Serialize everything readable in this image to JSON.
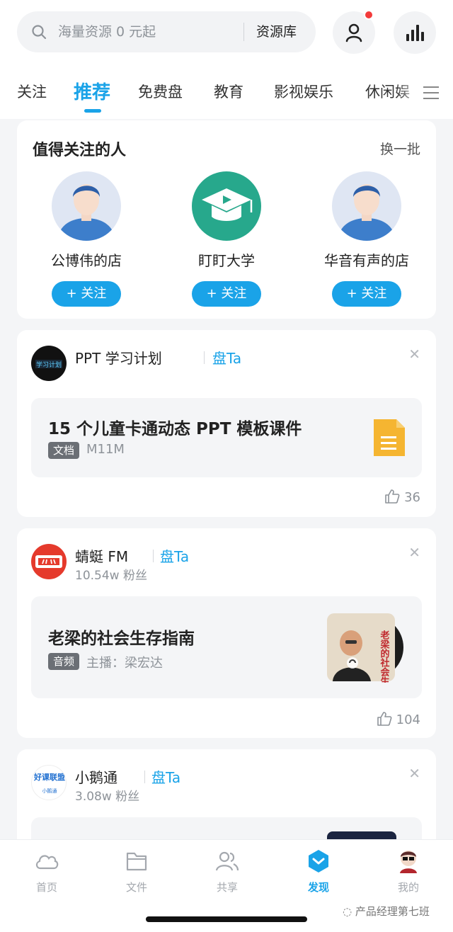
{
  "search": {
    "placeholder": "海量资源 0 元起",
    "library_label": "资源库"
  },
  "tabs": [
    "关注",
    "推荐",
    "免费盘",
    "教育",
    "影视娱乐",
    "休闲娱"
  ],
  "follow_section": {
    "title": "值得关注的人",
    "swap_label": "换一批",
    "people": [
      {
        "name": "公博伟的店",
        "button": "+ 关注"
      },
      {
        "name": "盯盯大学",
        "button": "+ 关注"
      },
      {
        "name": "华音有声的店",
        "button": "+ 关注"
      }
    ]
  },
  "feeds": [
    {
      "name": "PPT 学习计划",
      "pan_label": "盘Ta",
      "fans": "",
      "logo_text": "学习计划",
      "item_title": "15 个儿童卡通动态 PPT 模板课件",
      "tag": "文档",
      "meta": "M11M",
      "likes": "36"
    },
    {
      "name": "蜻蜓 FM",
      "pan_label": "盘Ta",
      "fans": "10.54w 粉丝",
      "item_title": "老梁的社会生存指南",
      "tag": "音频",
      "meta": "主播：梁宏达",
      "cover_text": "老梁的社会生存指南",
      "likes": "104"
    },
    {
      "name": "小鹅通",
      "pan_label": "盘Ta",
      "fans": "3.08w 粉丝",
      "logo_text": "好课联盟",
      "logo_sub": "小鹅通"
    }
  ],
  "nav": [
    "首页",
    "文件",
    "共享",
    "发现",
    "我的"
  ],
  "watermark": "产品经理第七班",
  "colors": {
    "accent": "#1aa3e8",
    "badge_red": "#f33b3b",
    "doc_yellow": "#f5b531"
  }
}
